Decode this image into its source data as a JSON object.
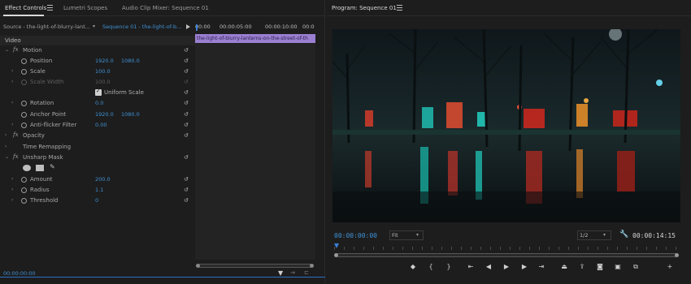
{
  "effect_controls": {
    "tabs": [
      {
        "label": "Effect Controls",
        "active": true
      },
      {
        "label": "Lumetri Scopes",
        "active": false
      },
      {
        "label": "Audio Clip Mixer: Sequence 01",
        "active": false
      }
    ],
    "source_label": "Source - the-light-of-blurry-lant...",
    "sequence_label": "Sequence 01 - the-light-of-b...",
    "ruler": [
      "00:00",
      "00:00:05:00",
      "00:00:10:00",
      "00:0"
    ],
    "clip_name": "the-light-of-blurry-lanterns-on-the-street-of-th",
    "section": "Video",
    "motion": {
      "label": "Motion",
      "position": {
        "label": "Position",
        "x": "1920.0",
        "y": "1080.0"
      },
      "scale": {
        "label": "Scale",
        "value": "100.0"
      },
      "scale_width": {
        "label": "Scale Width",
        "value": "100.0"
      },
      "uniform_scale": "Uniform Scale",
      "rotation": {
        "label": "Rotation",
        "value": "0.0"
      },
      "anchor_point": {
        "label": "Anchor Point",
        "x": "1920.0",
        "y": "1080.0"
      },
      "anti_flicker": {
        "label": "Anti-flicker Filter",
        "value": "0.00"
      }
    },
    "opacity": "Opacity",
    "time_remapping": "Time Remapping",
    "unsharp_mask": {
      "label": "Unsharp Mask",
      "amount": {
        "label": "Amount",
        "value": "200.0"
      },
      "radius": {
        "label": "Radius",
        "value": "1.1"
      },
      "threshold": {
        "label": "Threshold",
        "value": "0"
      }
    },
    "current_time": "00:00:00:00"
  },
  "program": {
    "title": "Program: Sequence 01",
    "timecode": "00:00:00:00",
    "zoom": "Fit",
    "resolution": "1/2",
    "duration": "00:00:14:15",
    "playhead_fraction": 0.0
  },
  "colors": {
    "accent": "#3f92d6",
    "clip": "#9a7fd1"
  }
}
